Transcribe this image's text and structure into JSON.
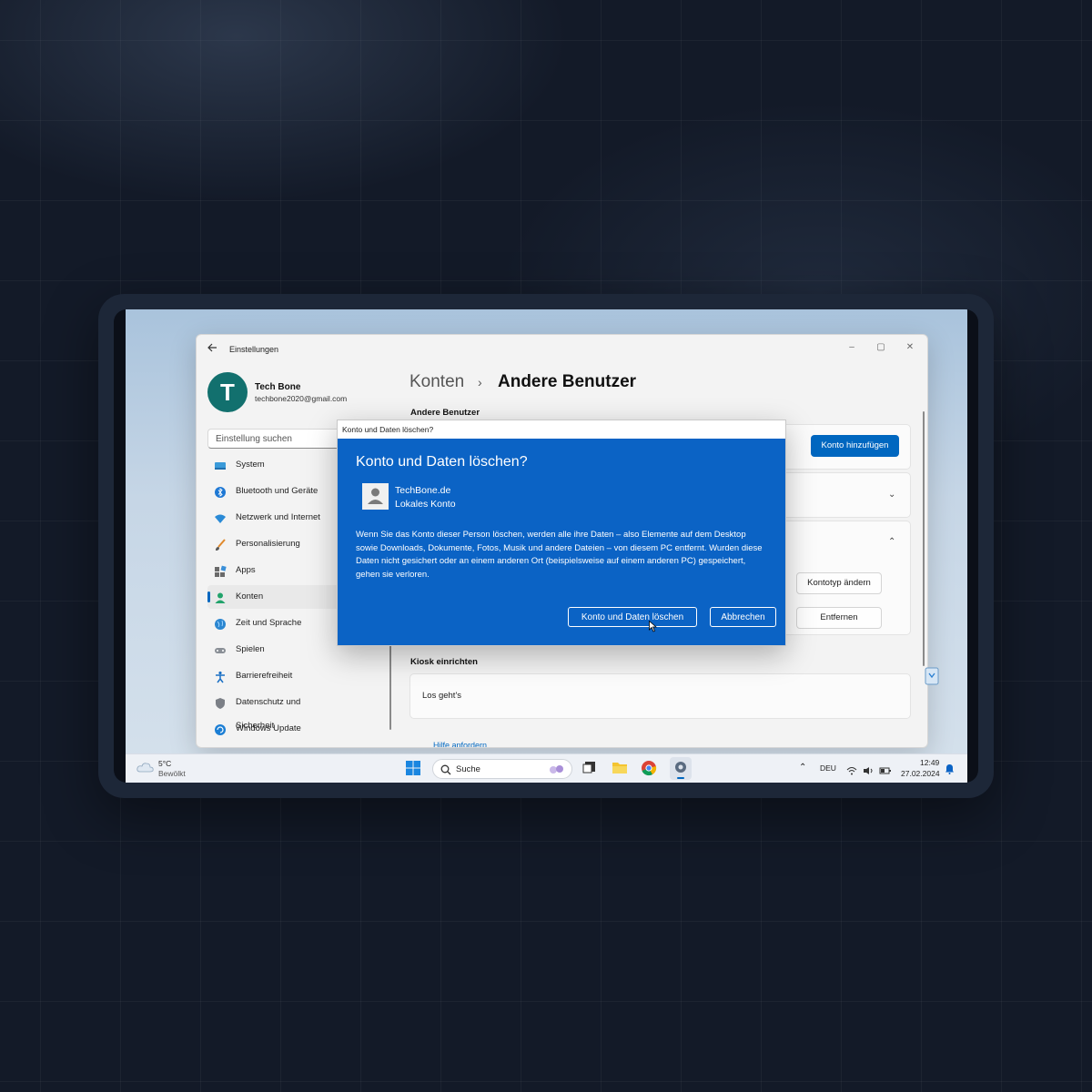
{
  "settings": {
    "app_title": "Einstellungen",
    "profile": {
      "initial": "T",
      "name": "Tech Bone",
      "email": "techbone2020@gmail.com"
    },
    "search_placeholder": "Einstellung suchen",
    "nav": [
      {
        "label": "System",
        "icon": "system-icon"
      },
      {
        "label": "Bluetooth und Geräte",
        "icon": "bluetooth-icon"
      },
      {
        "label": "Netzwerk und Internet",
        "icon": "wifi-icon"
      },
      {
        "label": "Personalisierung",
        "icon": "brush-icon"
      },
      {
        "label": "Apps",
        "icon": "apps-icon"
      },
      {
        "label": "Konten",
        "icon": "account-icon",
        "active": true
      },
      {
        "label": "Zeit und Sprache",
        "icon": "globe-clock-icon"
      },
      {
        "label": "Spielen",
        "icon": "gamepad-icon"
      },
      {
        "label": "Barrierefreiheit",
        "icon": "accessibility-icon"
      },
      {
        "label": "Datenschutz und Sicherheit",
        "icon": "shield-icon"
      },
      {
        "label": "Windows Update",
        "icon": "update-icon"
      }
    ],
    "breadcrumb": {
      "parent": "Konten",
      "separator": "›",
      "current": "Andere Benutzer"
    },
    "section_other_users": "Andere Benutzer",
    "add_account_button": "Konto hinzufügen",
    "change_type_button": "Kontotyp ändern",
    "remove_button": "Entfernen",
    "section_kiosk": "Kiosk einrichten",
    "kiosk_card_label": "Los geht's",
    "help_link": "Hilfe anfordern"
  },
  "dialog": {
    "window_title": "Konto und Daten löschen?",
    "heading": "Konto und Daten löschen?",
    "user_name": "TechBone.de",
    "user_type": "Lokales Konto",
    "message": "Wenn Sie das Konto dieser Person löschen, werden alle ihre Daten – also Elemente auf dem Desktop sowie Downloads, Dokumente, Fotos, Musik und andere Dateien – von diesem PC entfernt. Wurden diese Daten nicht gesichert oder an einem anderen Ort (beispielsweise auf einem anderen PC) gespeichert, gehen sie verloren.",
    "confirm_button": "Konto und Daten löschen",
    "cancel_button": "Abbrechen",
    "accent_color": "#0b63c5"
  },
  "taskbar": {
    "weather_temp": "5°C",
    "weather_desc": "Bewölkt",
    "search_label": "Suche",
    "language": "DEU",
    "time": "12:49",
    "date": "27.02.2024"
  }
}
